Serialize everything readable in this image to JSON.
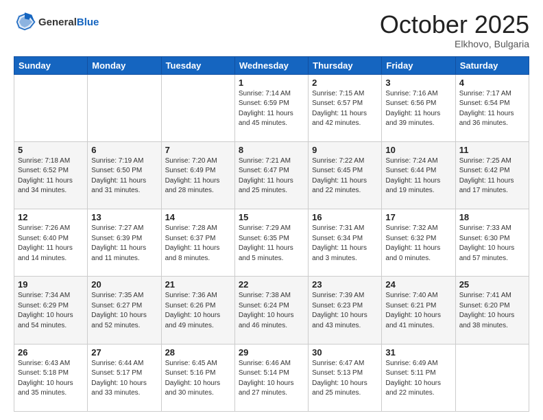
{
  "header": {
    "logo_general": "General",
    "logo_blue": "Blue",
    "month": "October 2025",
    "location": "Elkhovo, Bulgaria"
  },
  "weekdays": [
    "Sunday",
    "Monday",
    "Tuesday",
    "Wednesday",
    "Thursday",
    "Friday",
    "Saturday"
  ],
  "rows": [
    {
      "shaded": false,
      "cells": [
        {
          "day": "",
          "info": ""
        },
        {
          "day": "",
          "info": ""
        },
        {
          "day": "",
          "info": ""
        },
        {
          "day": "1",
          "info": "Sunrise: 7:14 AM\nSunset: 6:59 PM\nDaylight: 11 hours\nand 45 minutes."
        },
        {
          "day": "2",
          "info": "Sunrise: 7:15 AM\nSunset: 6:57 PM\nDaylight: 11 hours\nand 42 minutes."
        },
        {
          "day": "3",
          "info": "Sunrise: 7:16 AM\nSunset: 6:56 PM\nDaylight: 11 hours\nand 39 minutes."
        },
        {
          "day": "4",
          "info": "Sunrise: 7:17 AM\nSunset: 6:54 PM\nDaylight: 11 hours\nand 36 minutes."
        }
      ]
    },
    {
      "shaded": true,
      "cells": [
        {
          "day": "5",
          "info": "Sunrise: 7:18 AM\nSunset: 6:52 PM\nDaylight: 11 hours\nand 34 minutes."
        },
        {
          "day": "6",
          "info": "Sunrise: 7:19 AM\nSunset: 6:50 PM\nDaylight: 11 hours\nand 31 minutes."
        },
        {
          "day": "7",
          "info": "Sunrise: 7:20 AM\nSunset: 6:49 PM\nDaylight: 11 hours\nand 28 minutes."
        },
        {
          "day": "8",
          "info": "Sunrise: 7:21 AM\nSunset: 6:47 PM\nDaylight: 11 hours\nand 25 minutes."
        },
        {
          "day": "9",
          "info": "Sunrise: 7:22 AM\nSunset: 6:45 PM\nDaylight: 11 hours\nand 22 minutes."
        },
        {
          "day": "10",
          "info": "Sunrise: 7:24 AM\nSunset: 6:44 PM\nDaylight: 11 hours\nand 19 minutes."
        },
        {
          "day": "11",
          "info": "Sunrise: 7:25 AM\nSunset: 6:42 PM\nDaylight: 11 hours\nand 17 minutes."
        }
      ]
    },
    {
      "shaded": false,
      "cells": [
        {
          "day": "12",
          "info": "Sunrise: 7:26 AM\nSunset: 6:40 PM\nDaylight: 11 hours\nand 14 minutes."
        },
        {
          "day": "13",
          "info": "Sunrise: 7:27 AM\nSunset: 6:39 PM\nDaylight: 11 hours\nand 11 minutes."
        },
        {
          "day": "14",
          "info": "Sunrise: 7:28 AM\nSunset: 6:37 PM\nDaylight: 11 hours\nand 8 minutes."
        },
        {
          "day": "15",
          "info": "Sunrise: 7:29 AM\nSunset: 6:35 PM\nDaylight: 11 hours\nand 5 minutes."
        },
        {
          "day": "16",
          "info": "Sunrise: 7:31 AM\nSunset: 6:34 PM\nDaylight: 11 hours\nand 3 minutes."
        },
        {
          "day": "17",
          "info": "Sunrise: 7:32 AM\nSunset: 6:32 PM\nDaylight: 11 hours\nand 0 minutes."
        },
        {
          "day": "18",
          "info": "Sunrise: 7:33 AM\nSunset: 6:30 PM\nDaylight: 10 hours\nand 57 minutes."
        }
      ]
    },
    {
      "shaded": true,
      "cells": [
        {
          "day": "19",
          "info": "Sunrise: 7:34 AM\nSunset: 6:29 PM\nDaylight: 10 hours\nand 54 minutes."
        },
        {
          "day": "20",
          "info": "Sunrise: 7:35 AM\nSunset: 6:27 PM\nDaylight: 10 hours\nand 52 minutes."
        },
        {
          "day": "21",
          "info": "Sunrise: 7:36 AM\nSunset: 6:26 PM\nDaylight: 10 hours\nand 49 minutes."
        },
        {
          "day": "22",
          "info": "Sunrise: 7:38 AM\nSunset: 6:24 PM\nDaylight: 10 hours\nand 46 minutes."
        },
        {
          "day": "23",
          "info": "Sunrise: 7:39 AM\nSunset: 6:23 PM\nDaylight: 10 hours\nand 43 minutes."
        },
        {
          "day": "24",
          "info": "Sunrise: 7:40 AM\nSunset: 6:21 PM\nDaylight: 10 hours\nand 41 minutes."
        },
        {
          "day": "25",
          "info": "Sunrise: 7:41 AM\nSunset: 6:20 PM\nDaylight: 10 hours\nand 38 minutes."
        }
      ]
    },
    {
      "shaded": false,
      "cells": [
        {
          "day": "26",
          "info": "Sunrise: 6:43 AM\nSunset: 5:18 PM\nDaylight: 10 hours\nand 35 minutes."
        },
        {
          "day": "27",
          "info": "Sunrise: 6:44 AM\nSunset: 5:17 PM\nDaylight: 10 hours\nand 33 minutes."
        },
        {
          "day": "28",
          "info": "Sunrise: 6:45 AM\nSunset: 5:16 PM\nDaylight: 10 hours\nand 30 minutes."
        },
        {
          "day": "29",
          "info": "Sunrise: 6:46 AM\nSunset: 5:14 PM\nDaylight: 10 hours\nand 27 minutes."
        },
        {
          "day": "30",
          "info": "Sunrise: 6:47 AM\nSunset: 5:13 PM\nDaylight: 10 hours\nand 25 minutes."
        },
        {
          "day": "31",
          "info": "Sunrise: 6:49 AM\nSunset: 5:11 PM\nDaylight: 10 hours\nand 22 minutes."
        },
        {
          "day": "",
          "info": ""
        }
      ]
    }
  ]
}
